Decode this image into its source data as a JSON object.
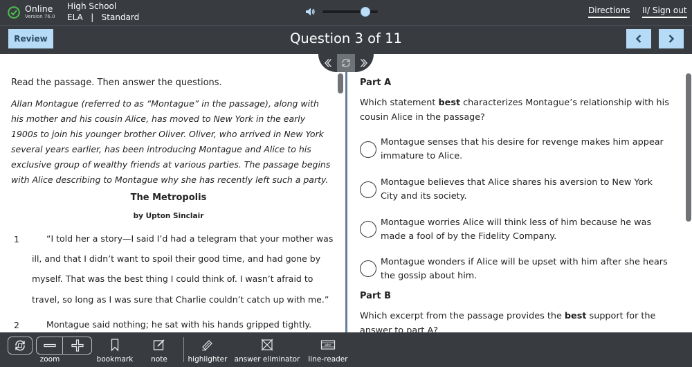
{
  "topbar": {
    "status": "Online",
    "version": "Version 76.0",
    "school": "High School",
    "subject": "ELA   |   Standard",
    "volume_level": 0.77,
    "directions_label": "Directions",
    "signout_label": "II/ Sign out"
  },
  "header": {
    "review_label": "Review",
    "title": "Question 3 of 11"
  },
  "passage": {
    "instruction": "Read the passage. Then answer the questions.",
    "intro": "Allan Montague (referred to as “Montague” in the passage), along with his mother and his cousin Alice, has moved to New York in the early 1900s to join his younger brother Oliver. Oliver, who arrived in New York several years earlier, has been introducing Montague and Alice to his exclusive group of wealthy friends at various parties. The passage begins with Alice describing to Montague why she has recently left such a party.",
    "title": "The Metropolis",
    "author": "by Upton Sinclair",
    "paragraphs": [
      {
        "num": "1",
        "text": "“I told her a story—I said I’d had a telegram that your mother was ill, and that I didn’t want to spoil their good time, and had gone by myself. That was the best thing I could think of. I wasn’t afraid to travel, so long as I was sure that Charlie couldn’t catch up with me.”"
      },
      {
        "num": "2",
        "text": "Montague said nothing; he sat with his hands gripped tightly."
      }
    ]
  },
  "question": {
    "partA": {
      "heading": "Part A",
      "prompt_pre": "Which statement ",
      "prompt_bold": "best",
      "prompt_post": " characterizes Montague’s relationship with his cousin Alice in the passage?",
      "options": [
        "Montague senses that his desire for revenge makes him appear immature to Alice.",
        "Montague believes that Alice shares his aversion to New York City and its society.",
        "Montague worries Alice will think less of him because he was made a fool of by the Fidelity Company.",
        "Montague wonders if Alice will be upset with him after she hears the gossip about him."
      ]
    },
    "partB": {
      "heading": "Part B",
      "prompt_pre": "Which excerpt from the passage provides the ",
      "prompt_bold": "best",
      "prompt_post": " support for the answer to part A?"
    }
  },
  "toolbar": {
    "zoom_label": "zoom",
    "bookmark_label": "bookmark",
    "note_label": "note",
    "highlighter_label": "highlighter",
    "eliminator_label": "answer eliminator",
    "linereader_label": "line-reader",
    "linereader_icon_text": "abc"
  },
  "colors": {
    "bar": "#383c41",
    "button": "#b6dbf6",
    "status_green": "#4cc04c",
    "split": "#647f99"
  }
}
